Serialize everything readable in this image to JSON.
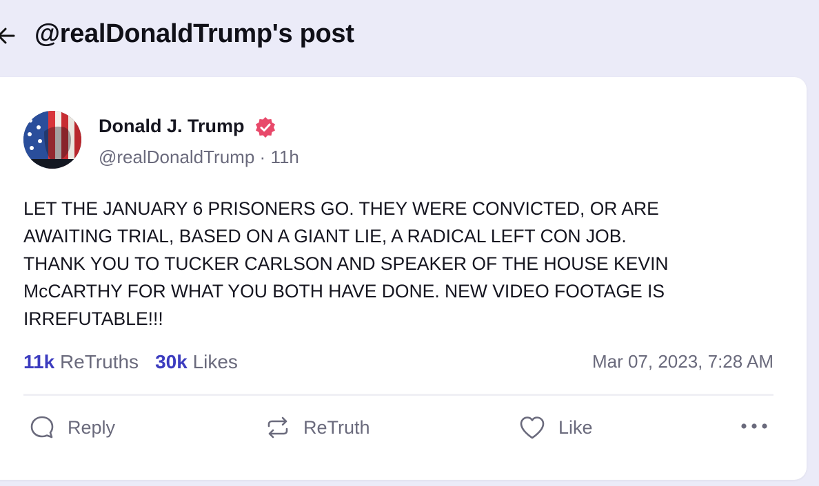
{
  "header": {
    "title": "@realDonaldTrump's post",
    "back_icon": "arrow-left-icon"
  },
  "post": {
    "author_name": "Donald J. Trump",
    "verified_icon": "verified-badge-icon",
    "handle": "@realDonaldTrump",
    "separator": "·",
    "age": "11h",
    "text": "LET THE JANUARY 6 PRISONERS GO. THEY WERE CONVICTED, OR ARE\nAWAITING TRIAL, BASED ON A GIANT LIE, A RADICAL LEFT CON JOB.\nTHANK YOU TO TUCKER CARLSON AND SPEAKER OF THE HOUSE KEVIN\nMcCARTHY FOR WHAT YOU BOTH HAVE DONE. NEW VIDEO FOOTAGE IS\nIRREFUTABLE!!!",
    "retruths_count": "11k",
    "retruths_label": "ReTruths",
    "likes_count": "30k",
    "likes_label": "Likes",
    "timestamp": "Mar 07, 2023, 7:28 AM"
  },
  "actions": {
    "reply_label": "Reply",
    "retruth_label": "ReTruth",
    "like_label": "Like",
    "more_icon": "more-dots-icon"
  },
  "colors": {
    "background": "#ebebf8",
    "accent": "#3c3cbf",
    "verified": "#e8496a",
    "muted_text": "#6a6a7c"
  }
}
